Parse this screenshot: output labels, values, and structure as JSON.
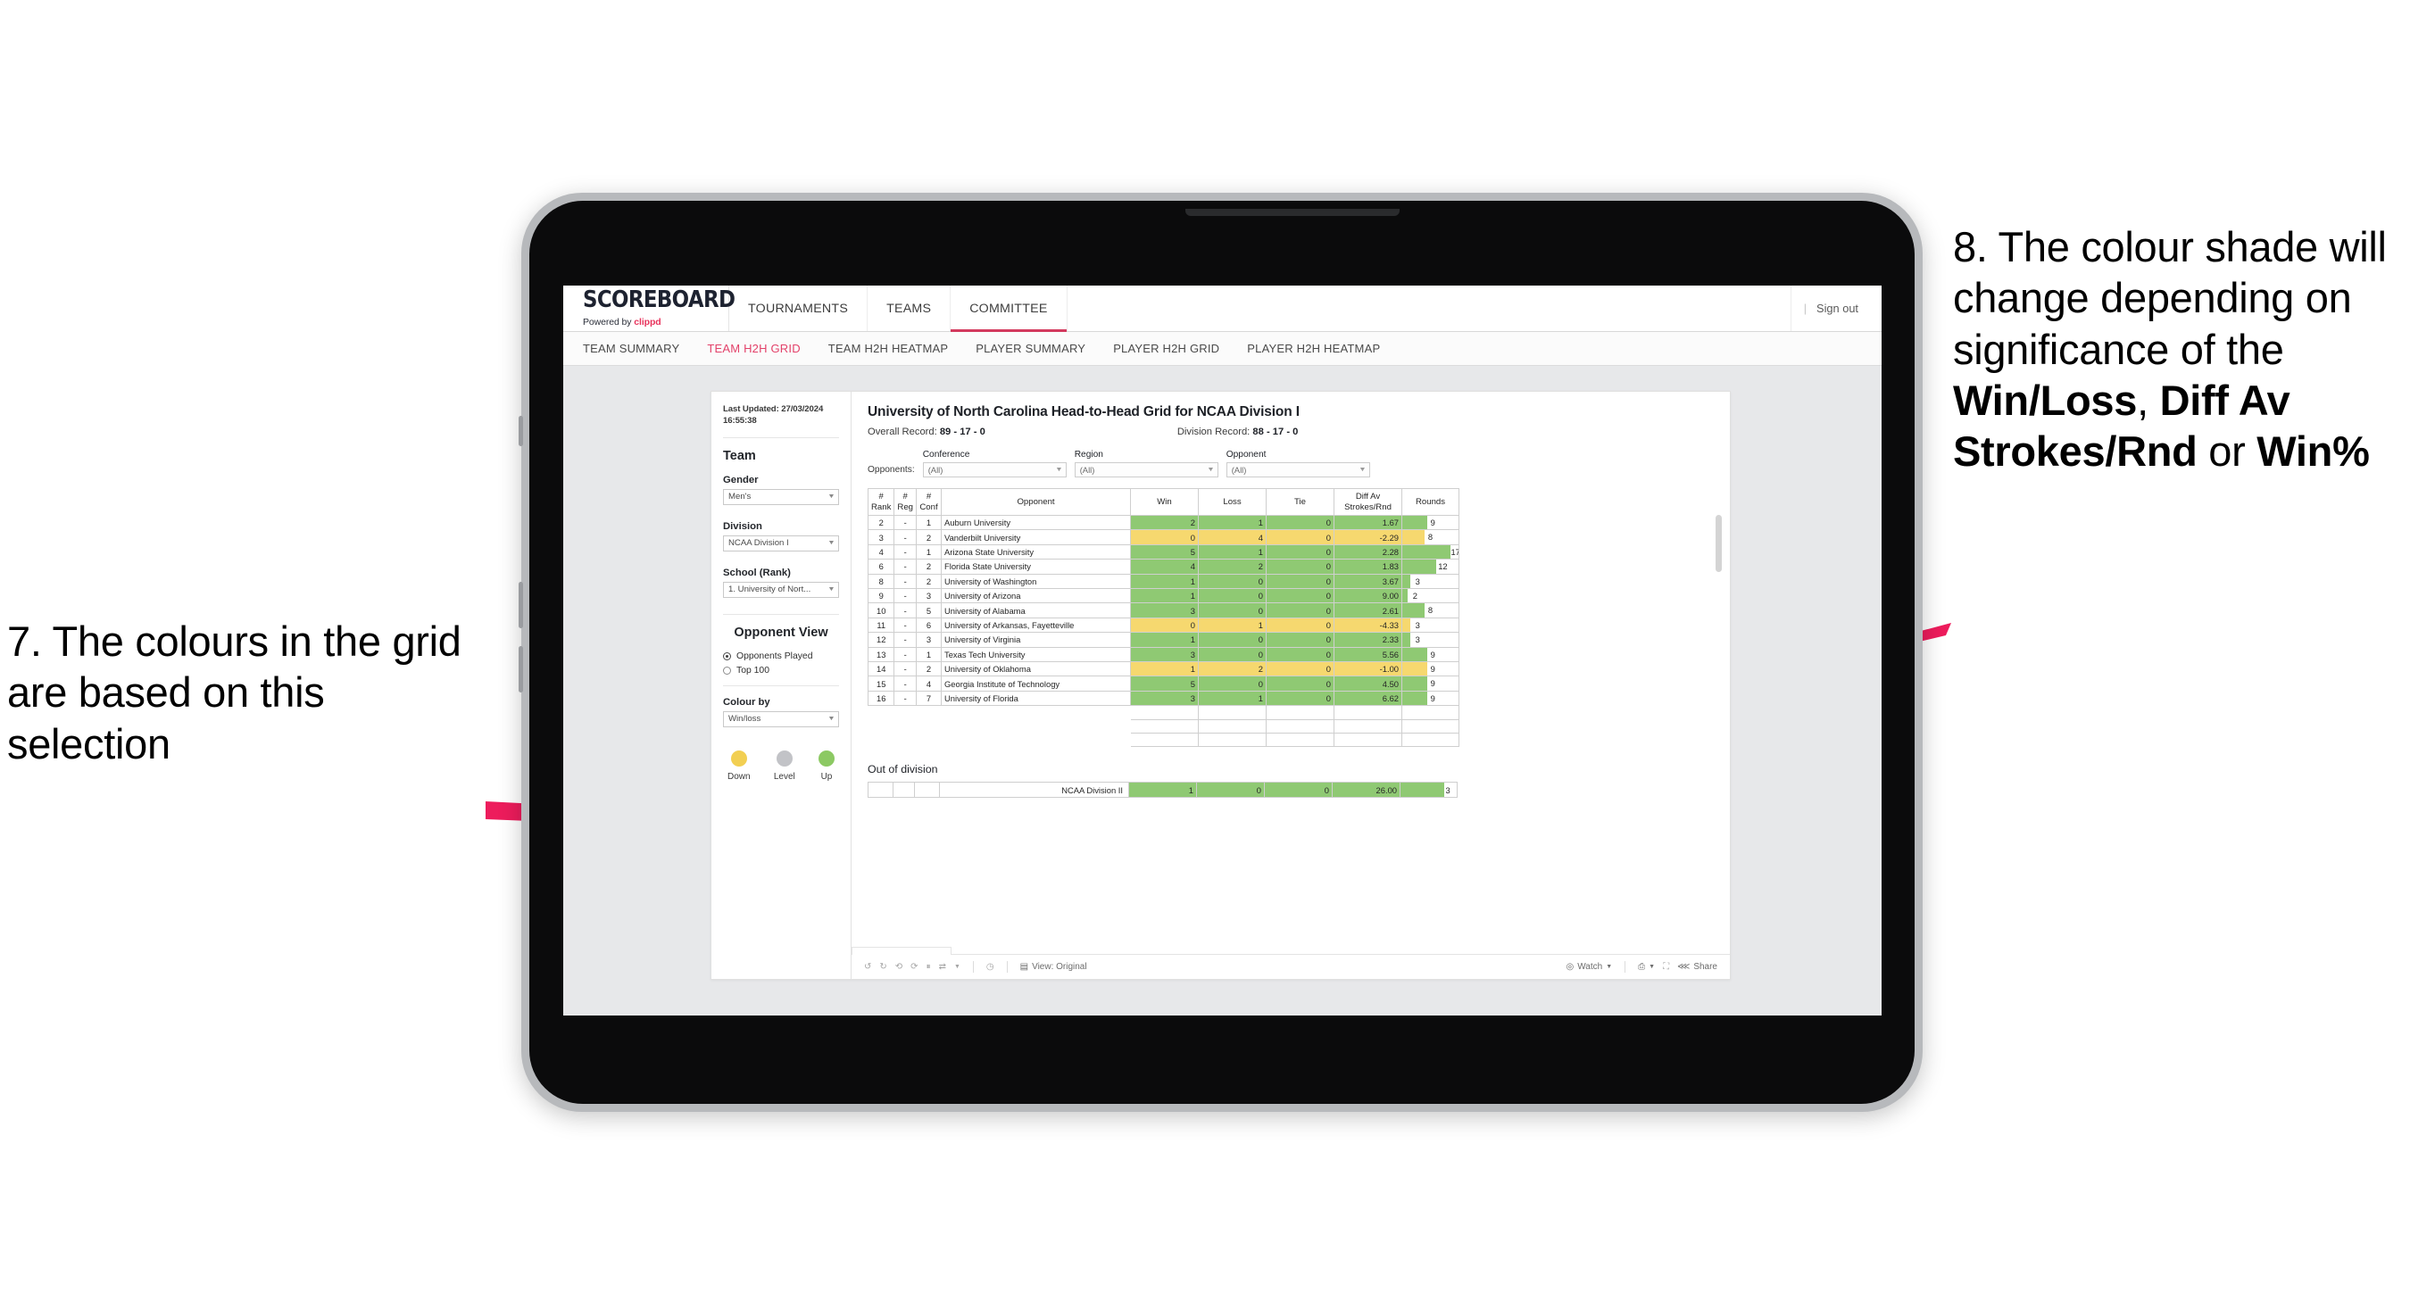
{
  "annotations": {
    "left": {
      "id": "7.",
      "text": "7. The colours in the grid are based on this selection"
    },
    "right": {
      "lead": "8. The colour shade will change depending on significance of the ",
      "b1": "Win/Loss",
      "mid1": ", ",
      "b2": "Diff Av Strokes/Rnd",
      "mid2": " or ",
      "b3": "Win%"
    },
    "arrow_color": "#ED1C5C"
  },
  "app": {
    "brand": {
      "title": "SCOREBOARD",
      "powered_by": "Powered by ",
      "clippd": "clippd"
    },
    "main_tabs": [
      {
        "label": "TOURNAMENTS",
        "active": false
      },
      {
        "label": "TEAMS",
        "active": false
      },
      {
        "label": "COMMITTEE",
        "active": true
      }
    ],
    "header_right": {
      "divider": "|",
      "sign_out": "Sign out"
    },
    "sub_tabs": [
      {
        "label": "TEAM SUMMARY",
        "active": false
      },
      {
        "label": "TEAM H2H GRID",
        "active": true
      },
      {
        "label": "TEAM H2H HEATMAP",
        "active": false
      },
      {
        "label": "PLAYER SUMMARY",
        "active": false
      },
      {
        "label": "PLAYER H2H GRID",
        "active": false
      },
      {
        "label": "PLAYER H2H HEATMAP",
        "active": false
      }
    ]
  },
  "sidebar": {
    "last_updated": "Last Updated: 27/03/2024 16:55:38",
    "team_heading": "Team",
    "gender": {
      "label": "Gender",
      "value": "Men's"
    },
    "division": {
      "label": "Division",
      "value": "NCAA Division I"
    },
    "school": {
      "label": "School (Rank)",
      "value": "1. University of Nort..."
    },
    "opponent_view": {
      "heading": "Opponent View",
      "options": [
        {
          "label": "Opponents Played",
          "selected": true
        },
        {
          "label": "Top 100",
          "selected": false
        }
      ]
    },
    "colour_by": {
      "label": "Colour by",
      "value": "Win/loss"
    },
    "legend": [
      {
        "label": "Down",
        "color": "#f2cf52"
      },
      {
        "label": "Level",
        "color": "#c2c3c7"
      },
      {
        "label": "Up",
        "color": "#8cc963"
      }
    ]
  },
  "viz": {
    "title": "University of North Carolina Head-to-Head Grid for NCAA Division I",
    "overall_record_label": "Overall Record: ",
    "overall_record": "89 - 17 - 0",
    "division_record_label": "Division Record: ",
    "division_record": "88 - 17 - 0",
    "opponents_label": "Opponents:",
    "filters": [
      {
        "label": "Conference",
        "value": "(All)"
      },
      {
        "label": "Region",
        "value": "(All)"
      },
      {
        "label": "Opponent",
        "value": "(All)"
      }
    ],
    "columns": [
      {
        "key": "rank",
        "l1": "#",
        "l2": "Rank"
      },
      {
        "key": "reg",
        "l1": "#",
        "l2": "Reg"
      },
      {
        "key": "conf",
        "l1": "#",
        "l2": "Conf"
      },
      {
        "key": "opponent",
        "l1": "Opponent",
        "l2": ""
      },
      {
        "key": "win",
        "l1": "Win",
        "l2": ""
      },
      {
        "key": "loss",
        "l1": "Loss",
        "l2": ""
      },
      {
        "key": "tie",
        "l1": "Tie",
        "l2": ""
      },
      {
        "key": "diff",
        "l1": "Diff Av",
        "l2": "Strokes/Rnd"
      },
      {
        "key": "rounds",
        "l1": "Rounds",
        "l2": ""
      }
    ],
    "rows": [
      {
        "rank": "2",
        "reg": "-",
        "conf": "1",
        "opponent": "Auburn University",
        "win": "2",
        "loss": "1",
        "tie": "0",
        "diff": "1.67",
        "rounds": "9",
        "tone": "g",
        "bar": 45
      },
      {
        "rank": "3",
        "reg": "-",
        "conf": "2",
        "opponent": "Vanderbilt University",
        "win": "0",
        "loss": "4",
        "tie": "0",
        "diff": "-2.29",
        "rounds": "8",
        "tone": "y",
        "bar": 40
      },
      {
        "rank": "4",
        "reg": "-",
        "conf": "1",
        "opponent": "Arizona State University",
        "win": "5",
        "loss": "1",
        "tie": "0",
        "diff": "2.28",
        "rounds": "17",
        "tone": "g",
        "bar": 85
      },
      {
        "rank": "6",
        "reg": "-",
        "conf": "2",
        "opponent": "Florida State University",
        "win": "4",
        "loss": "2",
        "tie": "0",
        "diff": "1.83",
        "rounds": "12",
        "tone": "g",
        "bar": 60
      },
      {
        "rank": "8",
        "reg": "-",
        "conf": "2",
        "opponent": "University of Washington",
        "win": "1",
        "loss": "0",
        "tie": "0",
        "diff": "3.67",
        "rounds": "3",
        "tone": "g",
        "bar": 15
      },
      {
        "rank": "9",
        "reg": "-",
        "conf": "3",
        "opponent": "University of Arizona",
        "win": "1",
        "loss": "0",
        "tie": "0",
        "diff": "9.00",
        "rounds": "2",
        "tone": "g",
        "bar": 10
      },
      {
        "rank": "10",
        "reg": "-",
        "conf": "5",
        "opponent": "University of Alabama",
        "win": "3",
        "loss": "0",
        "tie": "0",
        "diff": "2.61",
        "rounds": "8",
        "tone": "g",
        "bar": 40
      },
      {
        "rank": "11",
        "reg": "-",
        "conf": "6",
        "opponent": "University of Arkansas, Fayetteville",
        "win": "0",
        "loss": "1",
        "tie": "0",
        "diff": "-4.33",
        "rounds": "3",
        "tone": "y",
        "bar": 15
      },
      {
        "rank": "12",
        "reg": "-",
        "conf": "3",
        "opponent": "University of Virginia",
        "win": "1",
        "loss": "0",
        "tie": "0",
        "diff": "2.33",
        "rounds": "3",
        "tone": "g",
        "bar": 15
      },
      {
        "rank": "13",
        "reg": "-",
        "conf": "1",
        "opponent": "Texas Tech University",
        "win": "3",
        "loss": "0",
        "tie": "0",
        "diff": "5.56",
        "rounds": "9",
        "tone": "g",
        "bar": 45
      },
      {
        "rank": "14",
        "reg": "-",
        "conf": "2",
        "opponent": "University of Oklahoma",
        "win": "1",
        "loss": "2",
        "tie": "0",
        "diff": "-1.00",
        "rounds": "9",
        "tone": "y",
        "bar": 45
      },
      {
        "rank": "15",
        "reg": "-",
        "conf": "4",
        "opponent": "Georgia Institute of Technology",
        "win": "5",
        "loss": "0",
        "tie": "0",
        "diff": "4.50",
        "rounds": "9",
        "tone": "g",
        "bar": 45
      },
      {
        "rank": "16",
        "reg": "-",
        "conf": "7",
        "opponent": "University of Florida",
        "win": "3",
        "loss": "1",
        "tie": "0",
        "diff": "6.62",
        "rounds": "9",
        "tone": "g",
        "bar": 45
      }
    ],
    "out_of_division": {
      "title": "Out of division",
      "row": {
        "opponent": "NCAA Division II",
        "win": "1",
        "loss": "0",
        "tie": "0",
        "diff": "26.00",
        "rounds": "3",
        "tone": "g",
        "bar": 78
      }
    }
  },
  "toolbar": {
    "view_label": "View: Original",
    "watch_label": "Watch",
    "share_label": "Share",
    "icons": [
      "undo-icon",
      "redo-icon",
      "revert-icon",
      "refresh-icon",
      "pause-icon",
      "swap-icon",
      "caret-down-icon",
      "help-icon",
      "view-icon",
      "watch-icon",
      "device-icon",
      "fullscreen-icon",
      "share-icon"
    ]
  }
}
